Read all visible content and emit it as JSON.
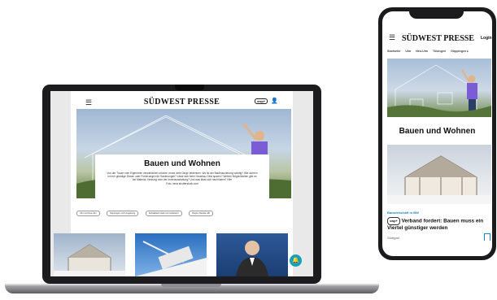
{
  "laptop": {
    "header": {
      "menu_icon": "hamburger-menu-icon",
      "logo": "SÜDWEST PRESSE",
      "badge": "swp+",
      "user_icon": "user-icon"
    },
    "hero": {
      "title": "Bauen und Wohnen",
      "text": "Von der Traum vom Eigenheim verwirklichen möchte, muss viele Dinge bedenken. Wo ist der Baufinanzierung wichtig? Wie sichern ich mir günstige Zinsen oder Förderungen für Sanierungen? Lässt sich beim Hausbau Geld sparen? Welche Möglichkeiten gibt es bei Material, Heizung oder der Innenausstattung? Und was lässt sich nachrüsten? Hier",
      "credit": "Foto: www.shutterstock.com"
    },
    "chips": [
      "Ulm und Neu-Ulm",
      "Göppingen und Umgebung",
      "Schwäbisch Hall und Crailsheim",
      "Region Neckar-Alb"
    ]
  },
  "phone": {
    "header": {
      "menu_icon": "hamburger-menu-icon",
      "logo": "SÜDWEST PRESSE",
      "login": "Login"
    },
    "nav": [
      "Startseite",
      "Ulm",
      "Neu-Ulm",
      "Tübingen",
      "Göppingen ▸"
    ],
    "section_title": "Bauen und Wohnen",
    "article": {
      "kicker": "Bauwirtschaft in BW",
      "badge": "swp+",
      "headline": "Verband fordert: Bauen muss ein Viertel günstiger werden",
      "place": "Stuttgart",
      "bookmark_icon": "bookmark-icon"
    }
  },
  "colors": {
    "accent": "#1b87c9",
    "fab": "#16a0b7",
    "device_frame": "#1b1b1d"
  }
}
